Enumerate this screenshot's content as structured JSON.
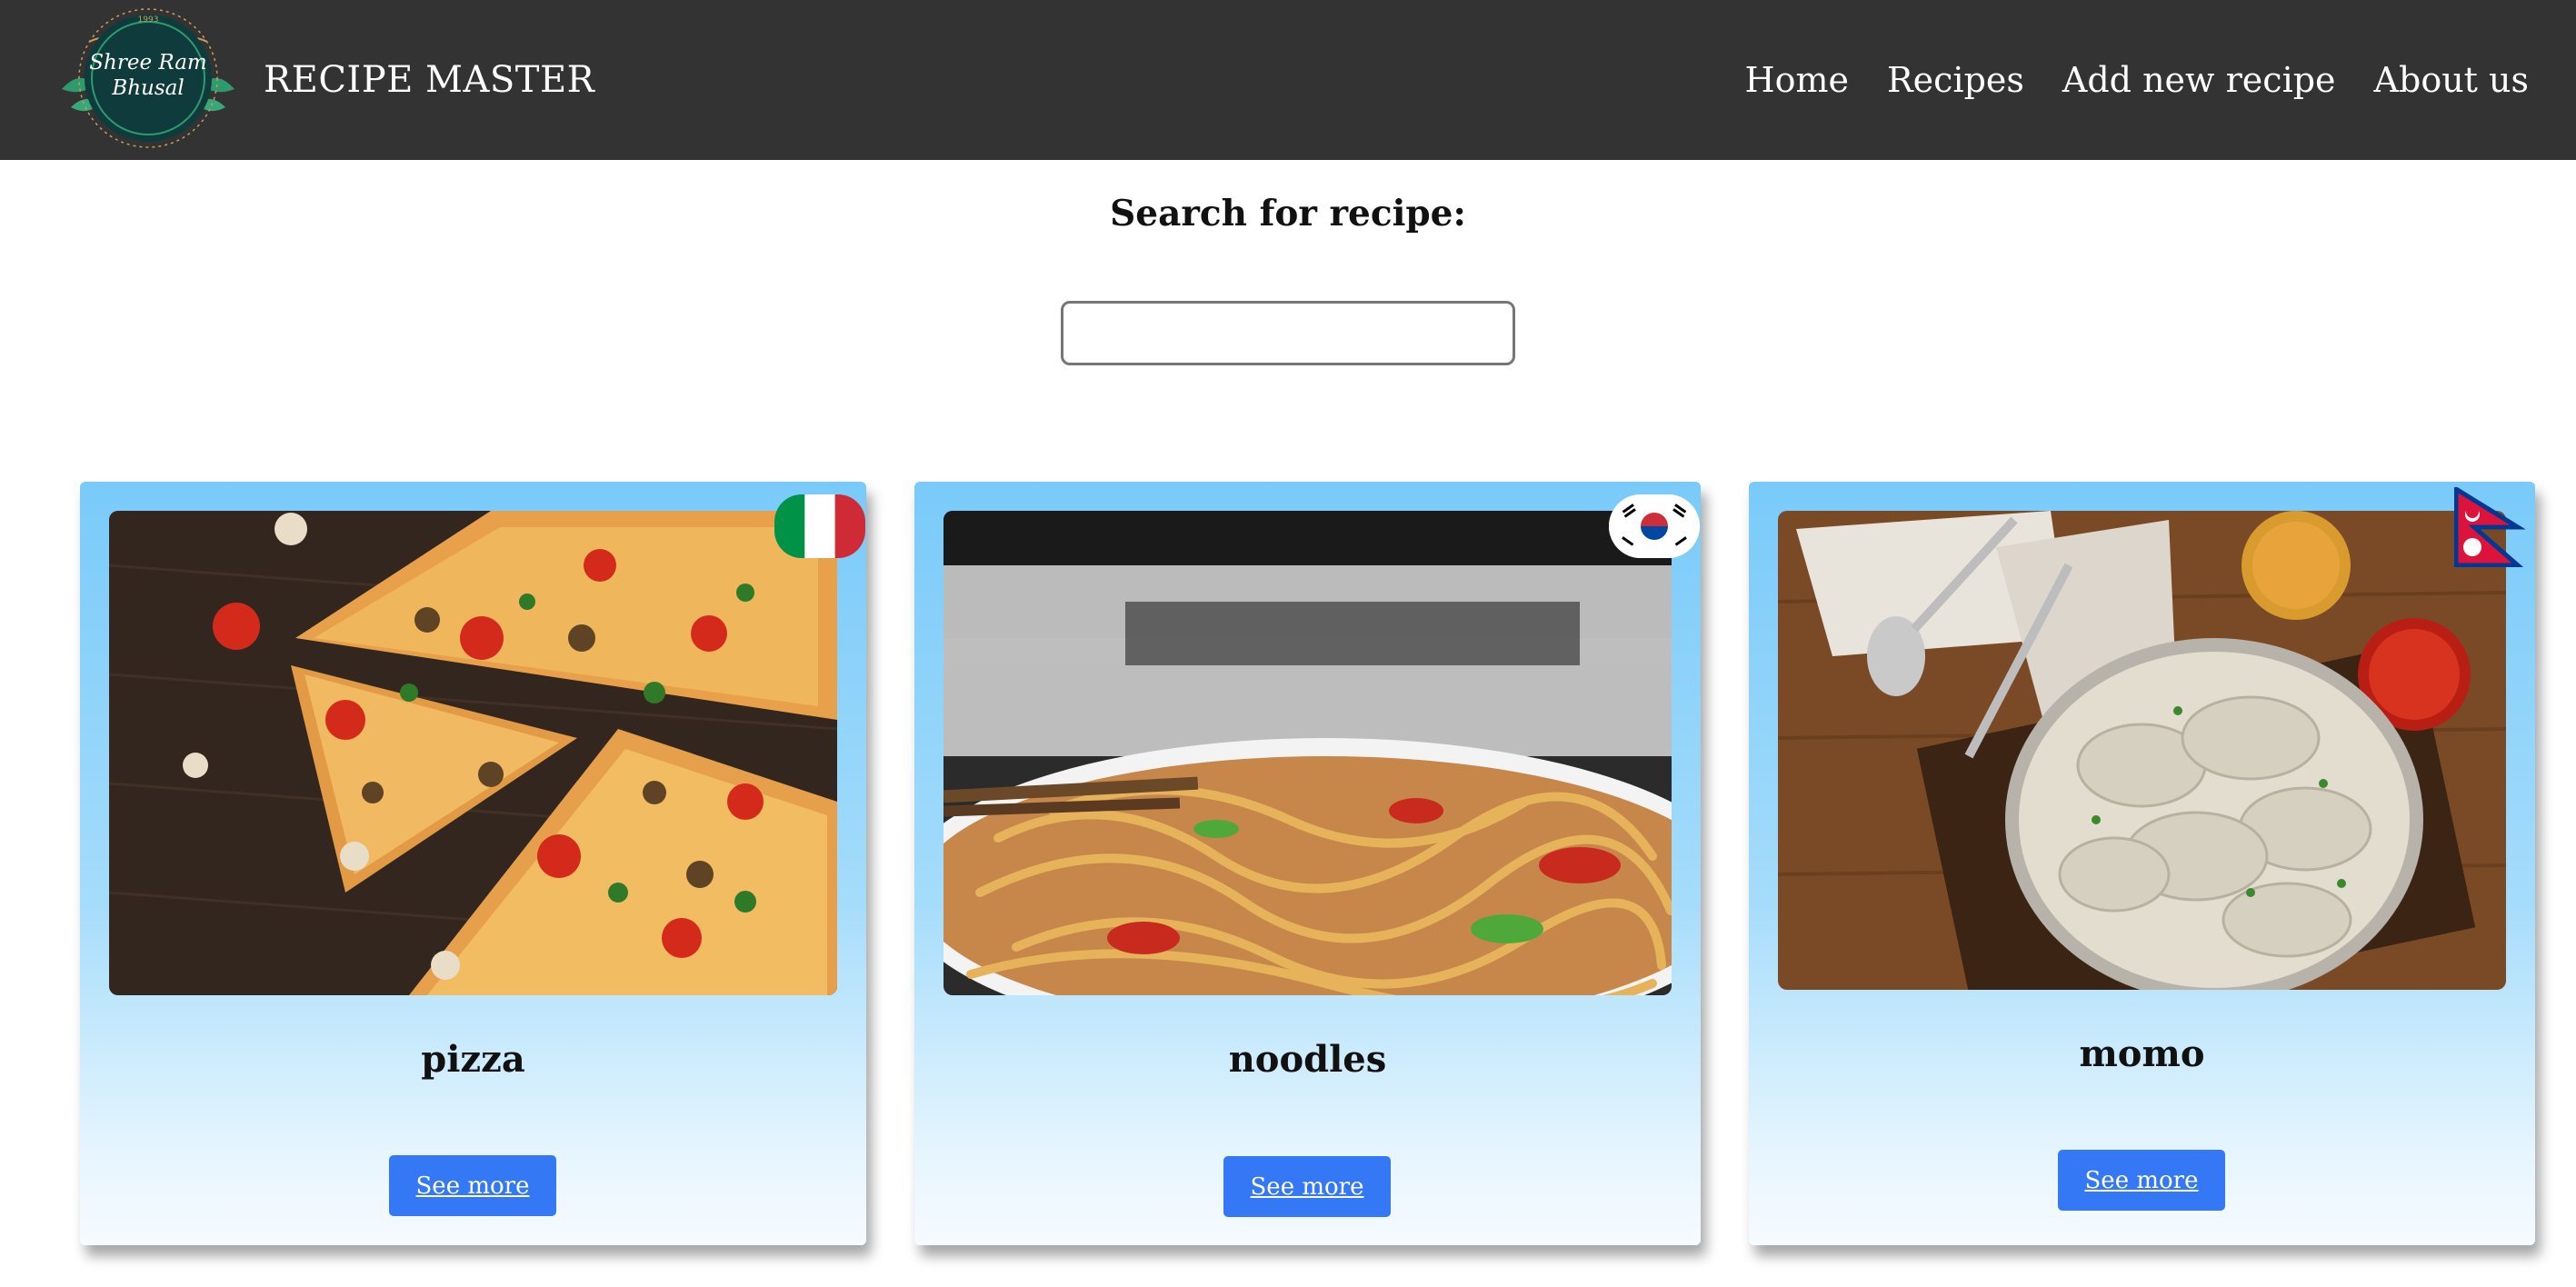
{
  "header": {
    "logo_text": "Shree Ram Bhusal",
    "logo_year": "1993",
    "brand": "RECIPE MASTER",
    "nav": [
      "Home",
      "Recipes",
      "Add new recipe",
      "About us"
    ]
  },
  "search": {
    "label": "Search for recipe:",
    "value": "",
    "placeholder": ""
  },
  "recipes": [
    {
      "title": "pizza",
      "flag": "italy-flag-icon",
      "button": "See more"
    },
    {
      "title": "noodles",
      "flag": "south-korea-flag-icon",
      "button": "See more"
    },
    {
      "title": "momo",
      "flag": "nepal-flag-icon",
      "button": "See more"
    }
  ],
  "colors": {
    "navbar": "#333333",
    "button": "#3478f6",
    "card_top": "#79cafa",
    "card_bottom": "#f6fbff"
  }
}
